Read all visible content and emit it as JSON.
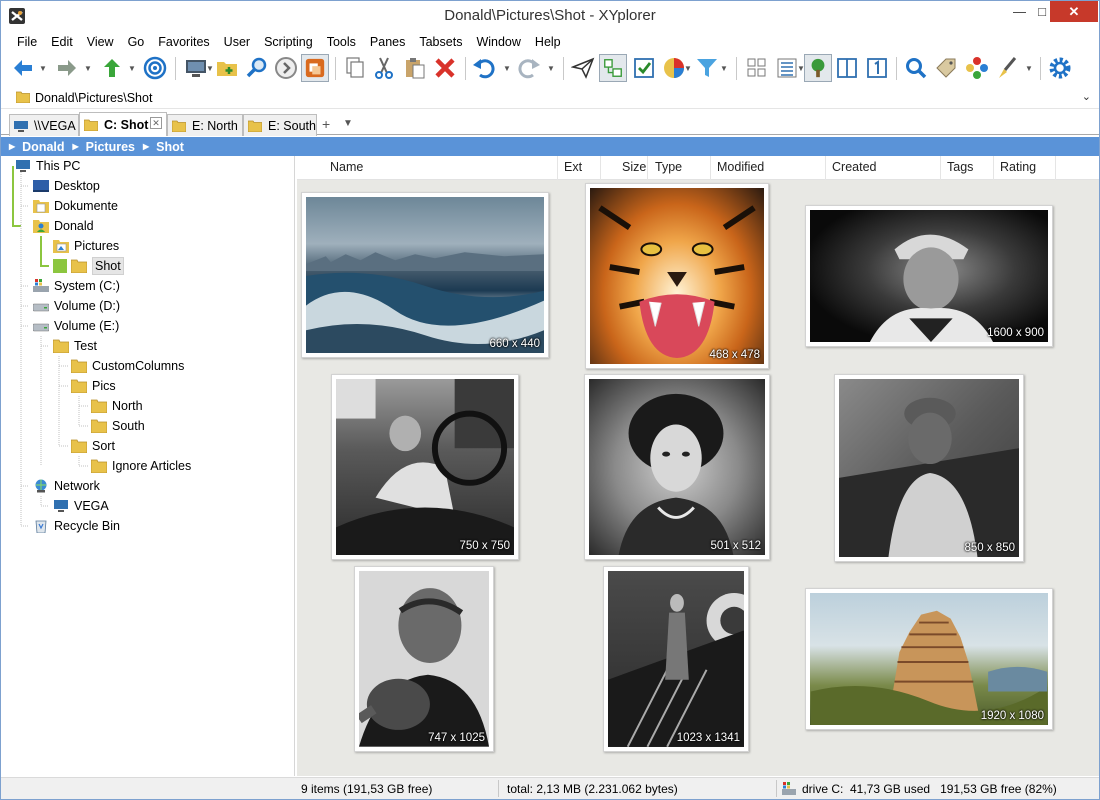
{
  "window": {
    "title": "Donald\\Pictures\\Shot - XYplorer",
    "min": "—",
    "max": "□",
    "close": "✕"
  },
  "menu": [
    "File",
    "Edit",
    "View",
    "Go",
    "Favorites",
    "User",
    "Scripting",
    "Tools",
    "Panes",
    "Tabsets",
    "Window",
    "Help"
  ],
  "toolbar": [
    {
      "name": "back-button",
      "icon": "arrow-left-icon"
    },
    {
      "name": "forward-button",
      "icon": "arrow-right-icon"
    },
    {
      "name": "up-button",
      "icon": "arrow-up-icon"
    },
    {
      "name": "target-button",
      "icon": "target-icon"
    },
    {
      "name": "computer-button",
      "icon": "computer-icon"
    },
    {
      "name": "new-folder-button",
      "icon": "folder-plus-icon"
    },
    {
      "name": "find-files-button",
      "icon": "magnifier-icon"
    },
    {
      "name": "go-forward-circle-button",
      "icon": "circle-arrow-icon"
    },
    {
      "name": "copy-to-button",
      "icon": "copy-to-icon"
    },
    {
      "name": "copy-button",
      "icon": "copy-icon"
    },
    {
      "name": "cut-button",
      "icon": "scissors-icon"
    },
    {
      "name": "paste-button",
      "icon": "paste-icon"
    },
    {
      "name": "delete-button",
      "icon": "delete-x-icon"
    },
    {
      "name": "undo-button",
      "icon": "undo-icon"
    },
    {
      "name": "redo-button",
      "icon": "redo-icon"
    },
    {
      "name": "send-button",
      "icon": "paper-plane-icon"
    },
    {
      "name": "dual-pane-button",
      "icon": "dual-pane-icon"
    },
    {
      "name": "checkbox-button",
      "icon": "checkbox-icon"
    },
    {
      "name": "color-filter-button",
      "icon": "color-filter-icon"
    },
    {
      "name": "visual-filter-button",
      "icon": "funnel-icon"
    },
    {
      "name": "thumbnails-button",
      "icon": "thumbnails-icon"
    },
    {
      "name": "details-button",
      "icon": "details-icon"
    },
    {
      "name": "tree-button",
      "icon": "tree-icon"
    },
    {
      "name": "panel-button",
      "icon": "panel-icon"
    },
    {
      "name": "one-pane-button",
      "icon": "one-icon"
    },
    {
      "name": "search-button",
      "icon": "search-icon"
    },
    {
      "name": "tag-button",
      "icon": "tag-icon"
    },
    {
      "name": "color-wheel-button",
      "icon": "flower-icon"
    },
    {
      "name": "highlight-button",
      "icon": "brush-icon"
    },
    {
      "name": "configuration-button",
      "icon": "gear-icon"
    }
  ],
  "address": "Donald\\Pictures\\Shot",
  "tabs": [
    {
      "label": "\\\\VEGA",
      "icon": "computer-icon"
    },
    {
      "label": "C: Shot",
      "icon": "folder-icon",
      "active": true
    },
    {
      "label": "E: North",
      "icon": "folder-icon"
    },
    {
      "label": "E: South",
      "icon": "folder-icon"
    }
  ],
  "tab_add": "+",
  "tab_menu": "▼",
  "breadcrumb": [
    "Donald",
    "Pictures",
    "Shot"
  ],
  "tree": [
    {
      "label": "This PC",
      "icon": "computer-icon"
    },
    {
      "label": "Desktop",
      "icon": "desktop-icon"
    },
    {
      "label": "Dokumente",
      "icon": "documents-icon"
    },
    {
      "label": "Donald",
      "icon": "user-folder-icon"
    },
    {
      "label": "Pictures",
      "icon": "pictures-folder-icon"
    },
    {
      "label": "Shot",
      "icon": "folder-icon",
      "selected": true
    },
    {
      "label": "System (C:)",
      "icon": "drive-system-icon"
    },
    {
      "label": "Volume (D:)",
      "icon": "drive-icon"
    },
    {
      "label": "Volume (E:)",
      "icon": "drive-icon"
    },
    {
      "label": "Test",
      "icon": "folder-icon"
    },
    {
      "label": "CustomColumns",
      "icon": "folder-icon"
    },
    {
      "label": "Pics",
      "icon": "folder-icon"
    },
    {
      "label": "North",
      "icon": "folder-icon"
    },
    {
      "label": "South",
      "icon": "folder-icon"
    },
    {
      "label": "Sort",
      "icon": "folder-icon"
    },
    {
      "label": "Ignore Articles",
      "icon": "folder-icon"
    },
    {
      "label": "Network",
      "icon": "network-icon"
    },
    {
      "label": "VEGA",
      "icon": "computer-icon"
    },
    {
      "label": "Recycle Bin",
      "icon": "recycle-bin-icon"
    }
  ],
  "columns": [
    "Name",
    "Ext",
    "Size",
    "Type",
    "Modified",
    "Created",
    "Tags",
    "Rating"
  ],
  "thumbnails": [
    {
      "dim": "660 x 440",
      "subject": "stormy sea waves"
    },
    {
      "dim": "468 x 478",
      "subject": "roaring tiger"
    },
    {
      "dim": "1600 x 900",
      "subject": "man with bandana portrait"
    },
    {
      "dim": "750 x 750",
      "subject": "man sleeping in car"
    },
    {
      "dim": "501 x 512",
      "subject": "portrait with curly hair"
    },
    {
      "dim": "850 x 850",
      "subject": "woman with hat"
    },
    {
      "dim": "747 x 1025",
      "subject": "man pointing"
    },
    {
      "dim": "1023 x 1341",
      "subject": "woman on stairs"
    },
    {
      "dim": "1920 x 1080",
      "subject": "tower of babel painting"
    }
  ],
  "status": {
    "items": "9 items (191,53 GB free)",
    "total": "total: 2,13 MB (2.231.062 bytes)",
    "drive": "drive C:  41,73 GB used   191,53 GB free (82%)"
  },
  "colors": {
    "accent": "#5a93d8",
    "close": "#c7392a",
    "tree_line": "#8cc63f",
    "folder": "#e8c24a"
  }
}
